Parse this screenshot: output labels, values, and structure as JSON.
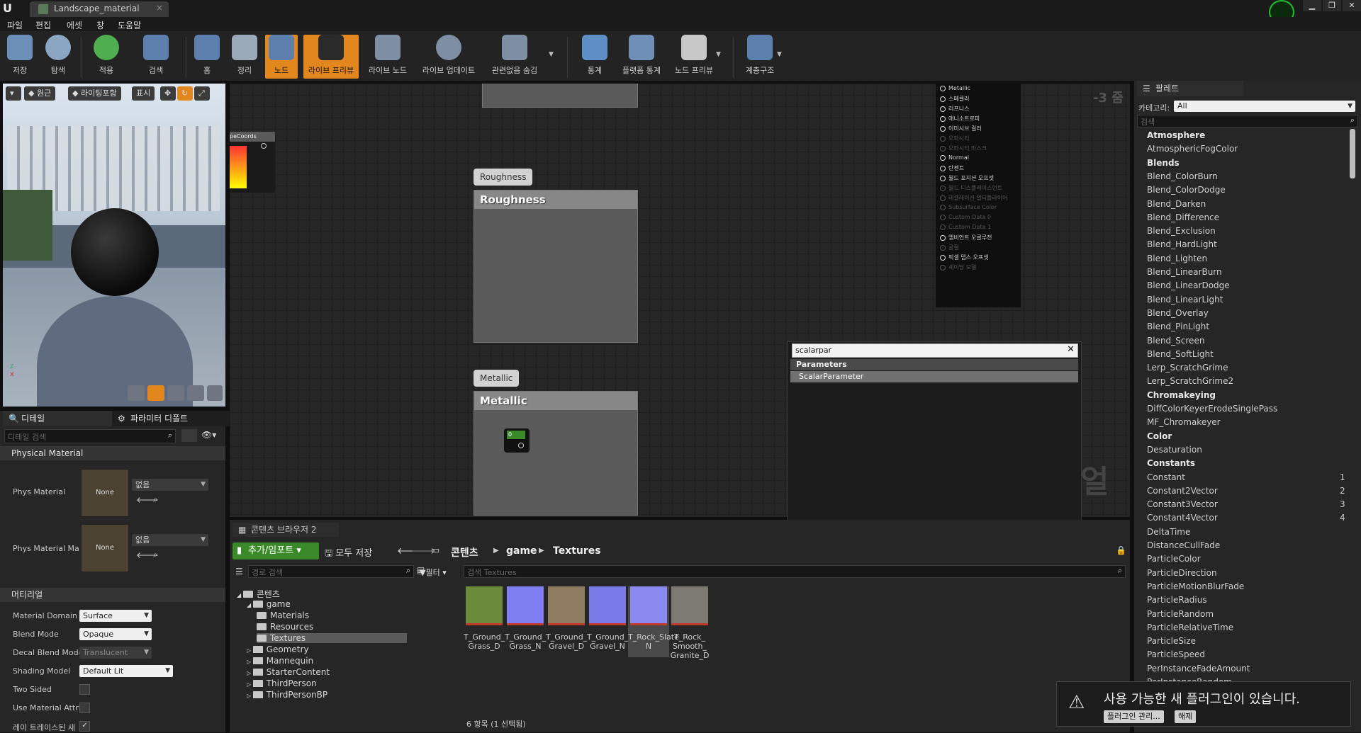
{
  "window": {
    "tab_title": "Landscape_material",
    "controls": [
      "▁",
      "❐",
      "✕"
    ]
  },
  "menu": [
    "파일",
    "편집",
    "에셋",
    "창",
    "도움말"
  ],
  "toolbar": [
    {
      "label": "저장",
      "icon": "save-icon"
    },
    {
      "label": "탐색",
      "icon": "search-icon"
    },
    {
      "label": "적용",
      "icon": "checkmark-icon"
    },
    {
      "label": "검색",
      "icon": "find-icon"
    },
    {
      "label": "홈",
      "icon": "home-icon"
    },
    {
      "label": "정리",
      "icon": "clean-icon"
    },
    {
      "label": "노드",
      "icon": "node-icon"
    },
    {
      "label": "라이브 프리뷰",
      "icon": "preview-icon"
    },
    {
      "label": "라이브 노드",
      "icon": "live-nodes-icon"
    },
    {
      "label": "라이브 업데이트",
      "icon": "live-update-icon"
    },
    {
      "label": "관련없음 숨김",
      "icon": "hide-unrelated-icon"
    },
    {
      "label": "통계",
      "icon": "stats-icon"
    },
    {
      "label": "플랫폼 통계",
      "icon": "platform-stats-icon"
    },
    {
      "label": "노드 프리뷰",
      "icon": "node-preview-icon"
    },
    {
      "label": "계층구조",
      "icon": "hierarchy-icon"
    }
  ],
  "viewport": {
    "perspective": "원근",
    "lighting": "라이팅포함",
    "show": "표시"
  },
  "details": {
    "tab_details": "디테일",
    "tab_params": "파라미터 디폴트",
    "search_placeholder": "디테일 검색",
    "physical_section": "Physical Material",
    "phys_material_label": "Phys Material",
    "phys_material_value": "없음",
    "phys_material_thumb": "None",
    "phys_material_map_label": "Phys Material Ma",
    "phys_material_map_value": "없음",
    "phys_material_map_thumb": "None",
    "material_section": "머티리얼",
    "props": [
      {
        "label": "Material Domain",
        "value": "Surface"
      },
      {
        "label": "Blend Mode",
        "value": "Opaque"
      },
      {
        "label": "Decal Blend Mode",
        "value": "Translucent"
      },
      {
        "label": "Shading Model",
        "value": "Default Lit"
      },
      {
        "label": "Two Sided",
        "value": ""
      },
      {
        "label": "Use Material Attri",
        "value": ""
      },
      {
        "label": "레이 트레이스된 새",
        "value": "✓"
      }
    ]
  },
  "graph": {
    "zoom": "-3 줌",
    "node_coords": "peCoords",
    "roughness_bubble": "Roughness",
    "roughness_title": "Roughness",
    "metallic_bubble": "Metallic",
    "metallic_title": "Metallic",
    "metallic_value": "0",
    "watermark": "얼",
    "pins": [
      {
        "label": "Metallic",
        "active": true
      },
      {
        "label": "스페큘러",
        "active": true
      },
      {
        "label": "러프니스",
        "active": true
      },
      {
        "label": "애니소트로피",
        "active": true
      },
      {
        "label": "이미시브 컬러",
        "active": true
      },
      {
        "label": "오파시티",
        "active": false
      },
      {
        "label": "오파시티 마스크",
        "active": false
      },
      {
        "label": "Normal",
        "active": true
      },
      {
        "label": "탄젠트",
        "active": true
      },
      {
        "label": "월드 포지션 오프셋",
        "active": true
      },
      {
        "label": "월드 디스플레이스먼트",
        "active": false
      },
      {
        "label": "테셀레이션 멀티플라이어",
        "active": false
      },
      {
        "label": "Subsurface Color",
        "active": false
      },
      {
        "label": "Custom Data 0",
        "active": false
      },
      {
        "label": "Custom Data 1",
        "active": false
      },
      {
        "label": "앰비언트 오클루전",
        "active": true
      },
      {
        "label": "굴절",
        "active": false
      },
      {
        "label": "픽셀 뎁스 오프셋",
        "active": true
      },
      {
        "label": "셰이딩 모델",
        "active": false
      }
    ]
  },
  "search_popup": {
    "query": "scalarpar",
    "category": "Parameters",
    "result": "ScalarParameter"
  },
  "palette": {
    "tab": "팔레트",
    "category_label": "카테고리:",
    "category_value": "All",
    "search_placeholder": "검색",
    "rows": [
      {
        "type": "cat",
        "text": "Atmosphere"
      },
      {
        "type": "item",
        "text": "AtmosphericFogColor"
      },
      {
        "type": "cat",
        "text": "Blends"
      },
      {
        "type": "item",
        "text": "Blend_ColorBurn"
      },
      {
        "type": "item",
        "text": "Blend_ColorDodge"
      },
      {
        "type": "item",
        "text": "Blend_Darken"
      },
      {
        "type": "item",
        "text": "Blend_Difference"
      },
      {
        "type": "item",
        "text": "Blend_Exclusion"
      },
      {
        "type": "item",
        "text": "Blend_HardLight"
      },
      {
        "type": "item",
        "text": "Blend_Lighten"
      },
      {
        "type": "item",
        "text": "Blend_LinearBurn"
      },
      {
        "type": "item",
        "text": "Blend_LinearDodge"
      },
      {
        "type": "item",
        "text": "Blend_LinearLight"
      },
      {
        "type": "item",
        "text": "Blend_Overlay"
      },
      {
        "type": "item",
        "text": "Blend_PinLight"
      },
      {
        "type": "item",
        "text": "Blend_Screen"
      },
      {
        "type": "item",
        "text": "Blend_SoftLight"
      },
      {
        "type": "item",
        "text": "Lerp_ScratchGrime"
      },
      {
        "type": "item",
        "text": "Lerp_ScratchGrime2"
      },
      {
        "type": "cat",
        "text": "Chromakeying"
      },
      {
        "type": "item",
        "text": "DiffColorKeyerErodeSinglePass"
      },
      {
        "type": "item",
        "text": "MF_Chromakeyer"
      },
      {
        "type": "cat",
        "text": "Color"
      },
      {
        "type": "item",
        "text": "Desaturation"
      },
      {
        "type": "cat",
        "text": "Constants"
      },
      {
        "type": "item",
        "text": "Constant",
        "key": "1"
      },
      {
        "type": "item",
        "text": "Constant2Vector",
        "key": "2"
      },
      {
        "type": "item",
        "text": "Constant3Vector",
        "key": "3"
      },
      {
        "type": "item",
        "text": "Constant4Vector",
        "key": "4"
      },
      {
        "type": "item",
        "text": "DeltaTime"
      },
      {
        "type": "item",
        "text": "DistanceCullFade"
      },
      {
        "type": "item",
        "text": "ParticleColor"
      },
      {
        "type": "item",
        "text": "ParticleDirection"
      },
      {
        "type": "item",
        "text": "ParticleMotionBlurFade"
      },
      {
        "type": "item",
        "text": "ParticleRadius"
      },
      {
        "type": "item",
        "text": "ParticleRandom"
      },
      {
        "type": "item",
        "text": "ParticleRelativeTime"
      },
      {
        "type": "item",
        "text": "ParticleSize"
      },
      {
        "type": "item",
        "text": "ParticleSpeed"
      },
      {
        "type": "item",
        "text": "PerInstanceFadeAmount"
      },
      {
        "type": "item",
        "text": "PerInstanceRandom"
      }
    ]
  },
  "content_browser": {
    "tab": "콘텐츠 브라우저 2",
    "add_import": "추가/임포트",
    "save_all": "모두 저장",
    "breadcrumb": [
      "콘텐츠",
      "game",
      "Textures"
    ],
    "path_search_placeholder": "경로 검색",
    "filter": "필터",
    "asset_search_placeholder": "검색 Textures",
    "tree": [
      {
        "label": "콘텐츠",
        "depth": 0,
        "expanded": true
      },
      {
        "label": "game",
        "depth": 1,
        "expanded": true
      },
      {
        "label": "Materials",
        "depth": 2
      },
      {
        "label": "Resources",
        "depth": 2
      },
      {
        "label": "Textures",
        "depth": 2,
        "selected": true
      },
      {
        "label": "Geometry",
        "depth": 1
      },
      {
        "label": "Mannequin",
        "depth": 1
      },
      {
        "label": "StarterContent",
        "depth": 1
      },
      {
        "label": "ThirdPerson",
        "depth": 1
      },
      {
        "label": "ThirdPersonBP",
        "depth": 1
      }
    ],
    "assets": [
      {
        "name": "T_Ground_\nGrass_D",
        "color": "#6b8a3a"
      },
      {
        "name": "T_Ground_\nGrass_N",
        "color": "#7f7ff2"
      },
      {
        "name": "T_Ground_\nGravel_D",
        "color": "#8f7b5f"
      },
      {
        "name": "T_Ground_\nGravel_N",
        "color": "#7a7ae8"
      },
      {
        "name": "T_Rock_Slate_\nN",
        "color": "#8a8af0",
        "selected": true
      },
      {
        "name": "T_Rock_\nSmooth_\nGranite_D",
        "color": "#7d7a73"
      }
    ],
    "status": "6 항목 (1 선택됨)"
  },
  "notification": {
    "message": "사용 가능한 새 플러그인이 있습니다.",
    "manage": "플러그인 관리...",
    "dismiss": "해제"
  },
  "colors": {
    "accent": "#e2861e",
    "add_button": "#3a8a2a"
  }
}
